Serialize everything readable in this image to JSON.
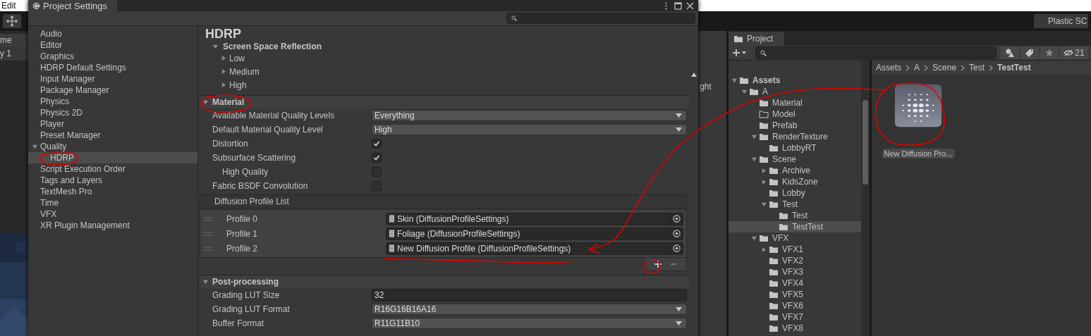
{
  "menu_bar": {
    "items": [
      "Edit"
    ]
  },
  "toolbar": {
    "plastic_button": "Plastic SC"
  },
  "scene_panel": {
    "tab": "me",
    "dropdown": "y 1"
  },
  "inspector_panel": {
    "text": "ght"
  },
  "settings_window": {
    "title": "Project Settings",
    "sidebar": [
      {
        "label": "Audio",
        "selected": false
      },
      {
        "label": "Editor",
        "selected": false
      },
      {
        "label": "Graphics",
        "selected": false
      },
      {
        "label": "HDRP Default Settings",
        "selected": false
      },
      {
        "label": "Input Manager",
        "selected": false
      },
      {
        "label": "Package Manager",
        "selected": false
      },
      {
        "label": "Physics",
        "selected": false
      },
      {
        "label": "Physics 2D",
        "selected": false
      },
      {
        "label": "Player",
        "selected": false
      },
      {
        "label": "Preset Manager",
        "selected": false
      },
      {
        "label": "Quality",
        "selected": false,
        "expanded": true,
        "children": [
          {
            "label": "HDRP",
            "selected": true
          }
        ]
      },
      {
        "label": "Script Execution Order",
        "selected": false
      },
      {
        "label": "Tags and Layers",
        "selected": false
      },
      {
        "label": "TextMesh Pro",
        "selected": false
      },
      {
        "label": "Time",
        "selected": false
      },
      {
        "label": "VFX",
        "selected": false
      },
      {
        "label": "XR Plugin Management",
        "selected": false
      }
    ],
    "page_title": "HDRP",
    "quality_group": {
      "label": "Screen Space Reflection",
      "expanded": true,
      "children": [
        {
          "label": "Low",
          "expanded": false
        },
        {
          "label": "Medium",
          "expanded": false
        },
        {
          "label": "High",
          "expanded": false
        }
      ]
    },
    "sections": [
      {
        "title": "Material",
        "expanded": true,
        "rows": [
          {
            "kind": "dropdown",
            "label": "Available Material Quality Levels",
            "value": "Everything"
          },
          {
            "kind": "dropdown",
            "label": "Default Material Quality Level",
            "value": "High"
          },
          {
            "kind": "checkbox",
            "label": "Distortion",
            "checked": true
          },
          {
            "kind": "checkbox",
            "label": "Subsurface Scattering",
            "checked": true,
            "children": [
              {
                "kind": "checkbox",
                "label": "High Quality",
                "checked": false
              }
            ]
          },
          {
            "kind": "checkbox",
            "label": "Fabric BSDF Convolution",
            "checked": false
          },
          {
            "kind": "list",
            "label": "Diffusion Profile List",
            "items": [
              {
                "label": "Profile 0",
                "value": "Skin (DiffusionProfileSettings)"
              },
              {
                "label": "Profile 1",
                "value": "Foliage (DiffusionProfileSettings)"
              },
              {
                "label": "Profile 2",
                "value": "New Diffusion Profile (DiffusionProfileSettings)"
              }
            ]
          }
        ]
      },
      {
        "title": "Post-processing",
        "expanded": true,
        "rows": [
          {
            "kind": "number",
            "label": "Grading LUT Size",
            "value": "32"
          },
          {
            "kind": "dropdown",
            "label": "Grading LUT Format",
            "value": "R16G16B16A16"
          },
          {
            "kind": "dropdown",
            "label": "Buffer Format",
            "value": "R11G11B10"
          }
        ]
      }
    ]
  },
  "project_panel": {
    "tab": "Project",
    "hidden_count": "21",
    "tree": [
      {
        "label": "Assets",
        "expanded": true,
        "selected": false,
        "children": [
          {
            "label": "A",
            "expanded": true,
            "selected": false,
            "children": [
              {
                "label": "Material",
                "selected": false
              },
              {
                "label": "Model",
                "selected": false,
                "empty": true
              },
              {
                "label": "Prefab",
                "selected": false
              },
              {
                "label": "RenderTexture",
                "expanded": true,
                "selected": false,
                "children": [
                  {
                    "label": "LobbyRT",
                    "selected": false
                  }
                ]
              },
              {
                "label": "Scene",
                "expanded": true,
                "selected": false,
                "children": [
                  {
                    "label": "Archive",
                    "expanded": false,
                    "selected": false
                  },
                  {
                    "label": "KidsZone",
                    "expanded": false,
                    "selected": false
                  },
                  {
                    "label": "Lobby",
                    "selected": false
                  },
                  {
                    "label": "Test",
                    "expanded": true,
                    "selected": false,
                    "children": [
                      {
                        "label": "Test",
                        "selected": false
                      },
                      {
                        "label": "TestTest",
                        "selected": true
                      }
                    ]
                  }
                ]
              },
              {
                "label": "VFX",
                "expanded": true,
                "selected": false,
                "children": [
                  {
                    "label": "VFX1",
                    "expanded": false,
                    "selected": false
                  },
                  {
                    "label": "VFX2",
                    "selected": false
                  },
                  {
                    "label": "VFX3",
                    "selected": false
                  },
                  {
                    "label": "VFX4",
                    "selected": false
                  },
                  {
                    "label": "VFX5",
                    "selected": false
                  },
                  {
                    "label": "VFX6",
                    "selected": false
                  },
                  {
                    "label": "VFX7",
                    "selected": false
                  },
                  {
                    "label": "VFX8",
                    "selected": false
                  }
                ]
              }
            ]
          }
        ]
      }
    ],
    "breadcrumb": [
      "Assets",
      "A",
      "Scene",
      "Test",
      "TestTest"
    ],
    "assets": [
      {
        "label": "New Diffusion Pro..."
      }
    ]
  }
}
